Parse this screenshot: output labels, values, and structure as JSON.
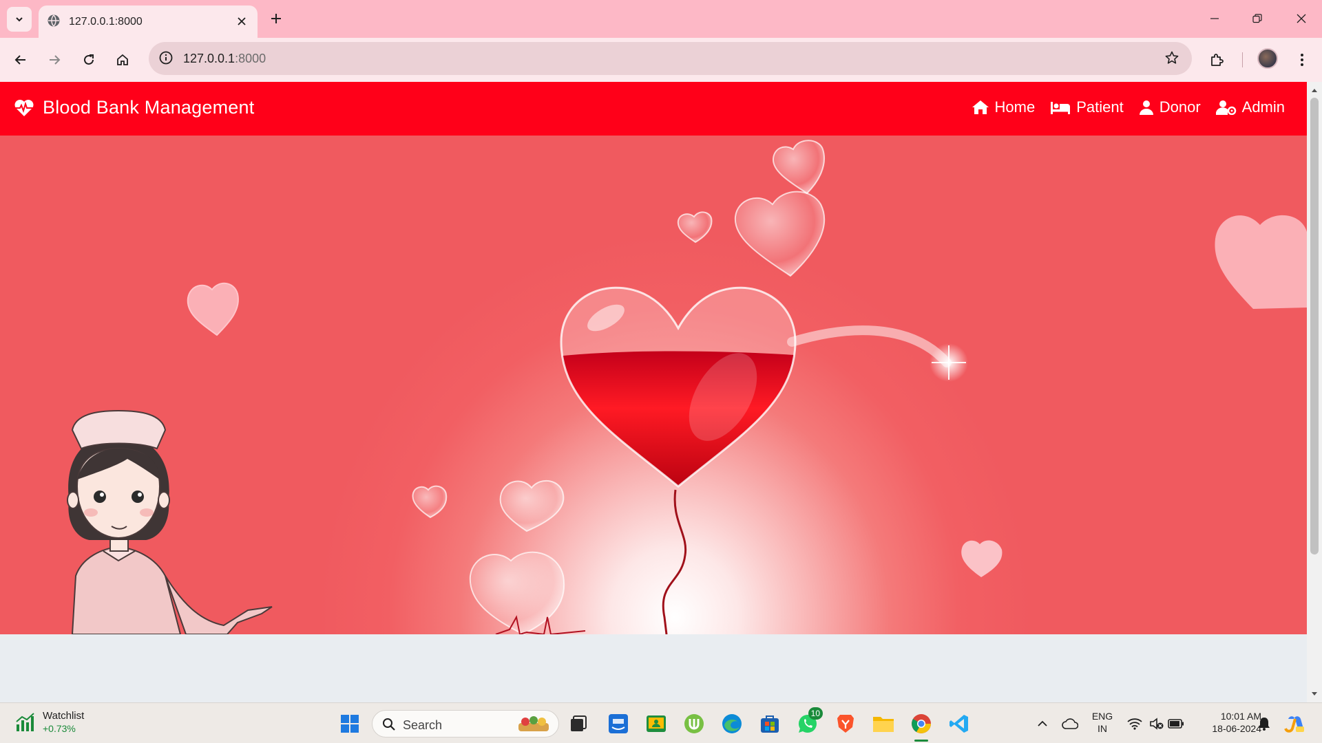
{
  "browser": {
    "tab_title": "127.0.0.1:8000",
    "url_host": "127.0.0.1",
    "url_port": ":8000"
  },
  "site": {
    "brand": "Blood Bank Management",
    "nav": [
      {
        "label": "Home",
        "icon": "home-icon"
      },
      {
        "label": "Patient",
        "icon": "bed-icon"
      },
      {
        "label": "Donor",
        "icon": "user-icon"
      },
      {
        "label": "Admin",
        "icon": "user-cog-icon"
      }
    ],
    "navbar_color": "#ff0019",
    "hero_background": "#f25f63"
  },
  "taskbar": {
    "watchlist_title": "Watchlist",
    "watchlist_change": "+0.73%",
    "search_placeholder": "Search",
    "whatsapp_badge": "10",
    "lang_line1": "ENG",
    "lang_line2": "IN",
    "time": "10:01 AM",
    "date": "18-06-2024"
  }
}
